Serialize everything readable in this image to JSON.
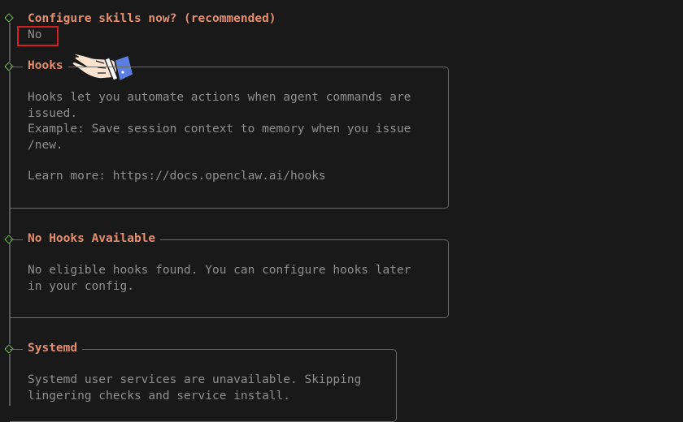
{
  "skills_prompt": {
    "question": "Configure skills now? (recommended)",
    "answer": "No"
  },
  "hooks": {
    "title": "Hooks",
    "lines": [
      "Hooks let you automate actions when agent commands are",
      "issued.",
      "Example: Save session context to memory when you issue",
      "/new.",
      "",
      "Learn more: https://docs.openclaw.ai/hooks"
    ]
  },
  "no_hooks": {
    "title": "No Hooks Available",
    "lines": [
      "No eligible hooks found. You can configure hooks later",
      "in your config."
    ]
  },
  "systemd": {
    "title": "Systemd",
    "lines": [
      "Systemd user services are unavailable. Skipping",
      "lingering checks and service install."
    ]
  },
  "colors": {
    "background": "#191919",
    "accent_orange": "#e58e6e",
    "diamond_green": "#6fbf54",
    "text_grey": "#8f8f8f",
    "highlight_red": "#d11f24"
  },
  "icons": [
    "step-diamond-icon",
    "pointing-hand-icon"
  ]
}
